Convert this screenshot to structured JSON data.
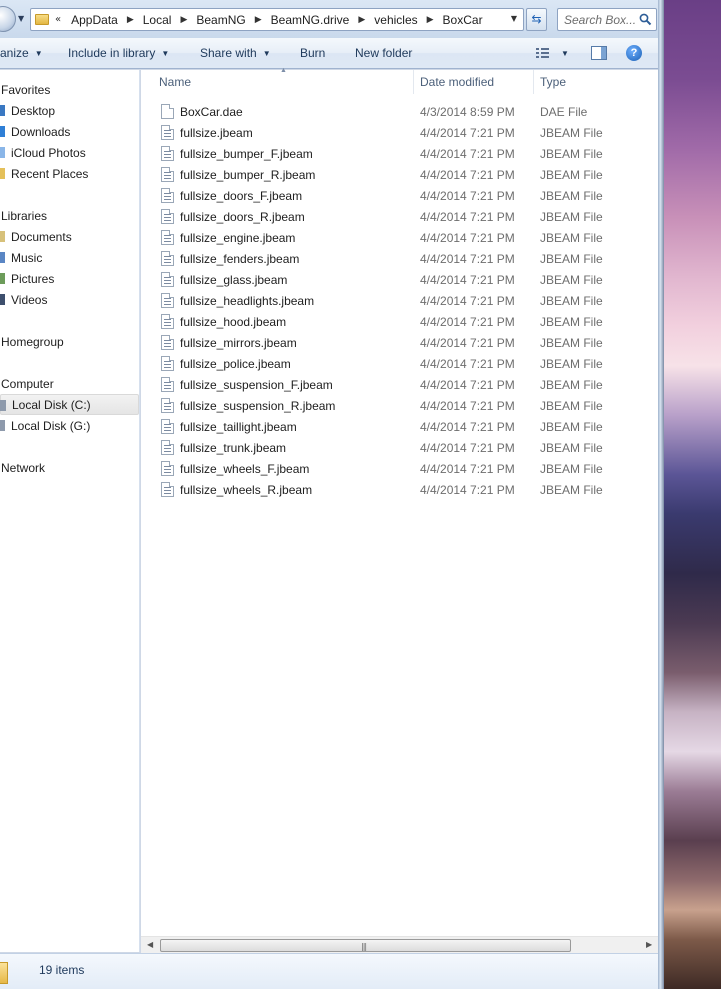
{
  "address_bar": {
    "breadcrumbs": [
      "AppData",
      "Local",
      "BeamNG",
      "BeamNG.drive",
      "vehicles",
      "BoxCar"
    ],
    "overflow_indicator": "«",
    "search_placeholder": "Search Box..."
  },
  "toolbar": {
    "organize": "anize",
    "include_in_library": "Include in library",
    "share_with": "Share with",
    "burn": "Burn",
    "new_folder": "New folder",
    "help": "?"
  },
  "navigation": {
    "favorites": {
      "label": "Favorites",
      "items": [
        "Desktop",
        "Downloads",
        "iCloud Photos",
        "Recent Places"
      ]
    },
    "libraries": {
      "label": "Libraries",
      "items": [
        "Documents",
        "Music",
        "Pictures",
        "Videos"
      ]
    },
    "homegroup": "Homegroup",
    "computer": {
      "label": "Computer",
      "items": [
        "Local Disk (C:)",
        "Local Disk (G:)"
      ],
      "selected": "Local Disk (C:)"
    },
    "network": "Network"
  },
  "columns": {
    "name": "Name",
    "date_modified": "Date modified",
    "type": "Type"
  },
  "files": [
    {
      "name": "BoxCar.dae",
      "date": "4/3/2014 8:59 PM",
      "type": "DAE File"
    },
    {
      "name": "fullsize.jbeam",
      "date": "4/4/2014 7:21 PM",
      "type": "JBEAM File"
    },
    {
      "name": "fullsize_bumper_F.jbeam",
      "date": "4/4/2014 7:21 PM",
      "type": "JBEAM File"
    },
    {
      "name": "fullsize_bumper_R.jbeam",
      "date": "4/4/2014 7:21 PM",
      "type": "JBEAM File"
    },
    {
      "name": "fullsize_doors_F.jbeam",
      "date": "4/4/2014 7:21 PM",
      "type": "JBEAM File"
    },
    {
      "name": "fullsize_doors_R.jbeam",
      "date": "4/4/2014 7:21 PM",
      "type": "JBEAM File"
    },
    {
      "name": "fullsize_engine.jbeam",
      "date": "4/4/2014 7:21 PM",
      "type": "JBEAM File"
    },
    {
      "name": "fullsize_fenders.jbeam",
      "date": "4/4/2014 7:21 PM",
      "type": "JBEAM File"
    },
    {
      "name": "fullsize_glass.jbeam",
      "date": "4/4/2014 7:21 PM",
      "type": "JBEAM File"
    },
    {
      "name": "fullsize_headlights.jbeam",
      "date": "4/4/2014 7:21 PM",
      "type": "JBEAM File"
    },
    {
      "name": "fullsize_hood.jbeam",
      "date": "4/4/2014 7:21 PM",
      "type": "JBEAM File"
    },
    {
      "name": "fullsize_mirrors.jbeam",
      "date": "4/4/2014 7:21 PM",
      "type": "JBEAM File"
    },
    {
      "name": "fullsize_police.jbeam",
      "date": "4/4/2014 7:21 PM",
      "type": "JBEAM File"
    },
    {
      "name": "fullsize_suspension_F.jbeam",
      "date": "4/4/2014 7:21 PM",
      "type": "JBEAM File"
    },
    {
      "name": "fullsize_suspension_R.jbeam",
      "date": "4/4/2014 7:21 PM",
      "type": "JBEAM File"
    },
    {
      "name": "fullsize_taillight.jbeam",
      "date": "4/4/2014 7:21 PM",
      "type": "JBEAM File"
    },
    {
      "name": "fullsize_trunk.jbeam",
      "date": "4/4/2014 7:21 PM",
      "type": "JBEAM File"
    },
    {
      "name": "fullsize_wheels_F.jbeam",
      "date": "4/4/2014 7:21 PM",
      "type": "JBEAM File"
    },
    {
      "name": "fullsize_wheels_R.jbeam",
      "date": "4/4/2014 7:21 PM",
      "type": "JBEAM File"
    }
  ],
  "status": {
    "item_count": "19 items"
  },
  "colors": {
    "toolbar_text": "#1e395b",
    "secondary_text": "#6d6d6d",
    "help_blue": "#1a5fb4"
  },
  "icons": {
    "address_folder": "folder-icon",
    "refresh": "refresh-icon",
    "search": "search-icon",
    "help": "help-icon",
    "views": "views-icon",
    "preview_pane": "preview-pane-icon"
  }
}
